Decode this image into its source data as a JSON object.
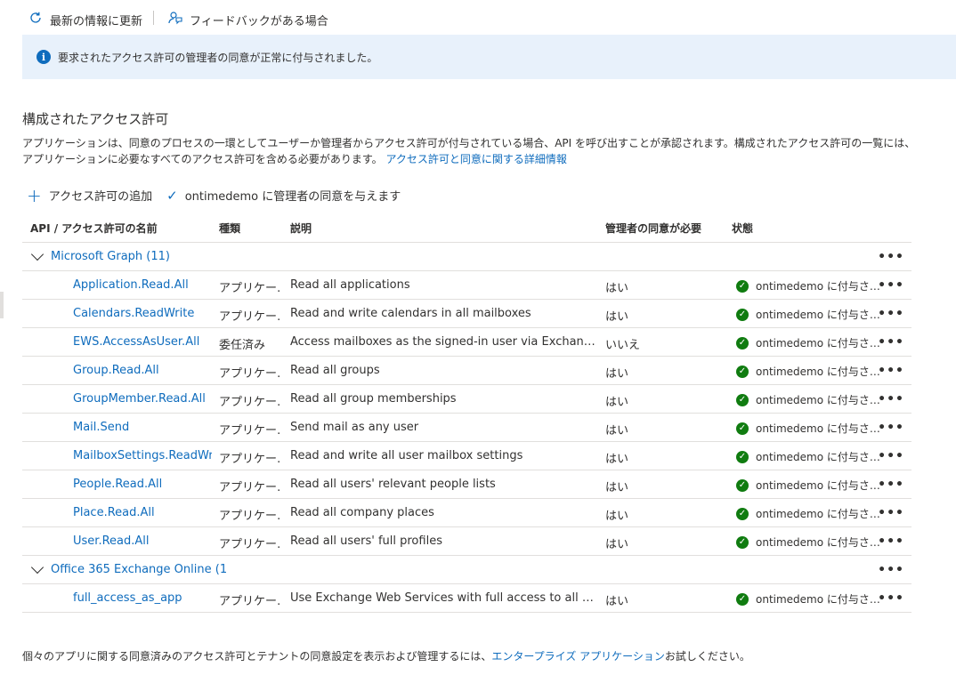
{
  "toolbar": {
    "refresh_label": "最新の情報に更新",
    "feedback_label": "フィードバックがある場合"
  },
  "banner": {
    "message": "要求されたアクセス許可の管理者の同意が正常に付与されました。"
  },
  "section": {
    "title": "構成されたアクセス許可",
    "description": "アプリケーションは、同意のプロセスの一環としてユーザーか管理者からアクセス許可が付与されている場合、API を呼び出すことが承認されます。構成されたアクセス許可の一覧には、アプリケーションに必要なすべてのアクセス許可を含める必要があります。",
    "learn_more_link": "アクセス許可と同意に関する詳細情報"
  },
  "actions": {
    "add_permission": "アクセス許可の追加",
    "grant_consent": "ontimedemo に管理者の同意を与えます"
  },
  "table": {
    "headers": {
      "name": "API / アクセス許可の名前",
      "type": "種類",
      "description": "説明",
      "admin_consent": "管理者の同意が必要",
      "status": "状態"
    },
    "groups": [
      {
        "label": "Microsoft Graph (11)",
        "rows": [
          {
            "name": "Application.Read.All",
            "type": "アプリケー…",
            "description": "Read all applications",
            "admin": "はい",
            "status": "ontimedemo に付与さ…"
          },
          {
            "name": "Calendars.ReadWrite",
            "type": "アプリケー…",
            "description": "Read and write calendars in all mailboxes",
            "admin": "はい",
            "status": "ontimedemo に付与さ…"
          },
          {
            "name": "EWS.AccessAsUser.All",
            "type": "委任済み",
            "description": "Access mailboxes as the signed-in user via Exchang…",
            "admin": "いいえ",
            "status": "ontimedemo に付与さ…"
          },
          {
            "name": "Group.Read.All",
            "type": "アプリケー…",
            "description": "Read all groups",
            "admin": "はい",
            "status": "ontimedemo に付与さ…"
          },
          {
            "name": "GroupMember.Read.All",
            "type": "アプリケー…",
            "description": "Read all group memberships",
            "admin": "はい",
            "status": "ontimedemo に付与さ…"
          },
          {
            "name": "Mail.Send",
            "type": "アプリケー…",
            "description": "Send mail as any user",
            "admin": "はい",
            "status": "ontimedemo に付与さ…"
          },
          {
            "name": "MailboxSettings.ReadWrite",
            "type": "アプリケー…",
            "description": "Read and write all user mailbox settings",
            "admin": "はい",
            "status": "ontimedemo に付与さ…"
          },
          {
            "name": "People.Read.All",
            "type": "アプリケー…",
            "description": "Read all users' relevant people lists",
            "admin": "はい",
            "status": "ontimedemo に付与さ…"
          },
          {
            "name": "Place.Read.All",
            "type": "アプリケー…",
            "description": "Read all company places",
            "admin": "はい",
            "status": "ontimedemo に付与さ…"
          },
          {
            "name": "User.Read.All",
            "type": "アプリケー…",
            "description": "Read all users' full profiles",
            "admin": "はい",
            "status": "ontimedemo に付与さ…"
          }
        ]
      },
      {
        "label": "Office 365 Exchange Online (1",
        "rows": [
          {
            "name": "full_access_as_app",
            "type": "アプリケー…",
            "description": "Use Exchange Web Services with full access to all m…",
            "admin": "はい",
            "status": "ontimedemo に付与さ…"
          }
        ]
      }
    ],
    "more_glyph": "•••"
  },
  "footer": {
    "text_before": "個々のアプリに関する同意済みのアクセス許可とテナントの同意設定を表示および管理するには、",
    "link": "エンタープライズ アプリケーション",
    "text_after": "お試しください。"
  },
  "colors": {
    "link": "#0f6cbd",
    "banner_bg": "#e8f1fb",
    "granted": "#107c10"
  }
}
